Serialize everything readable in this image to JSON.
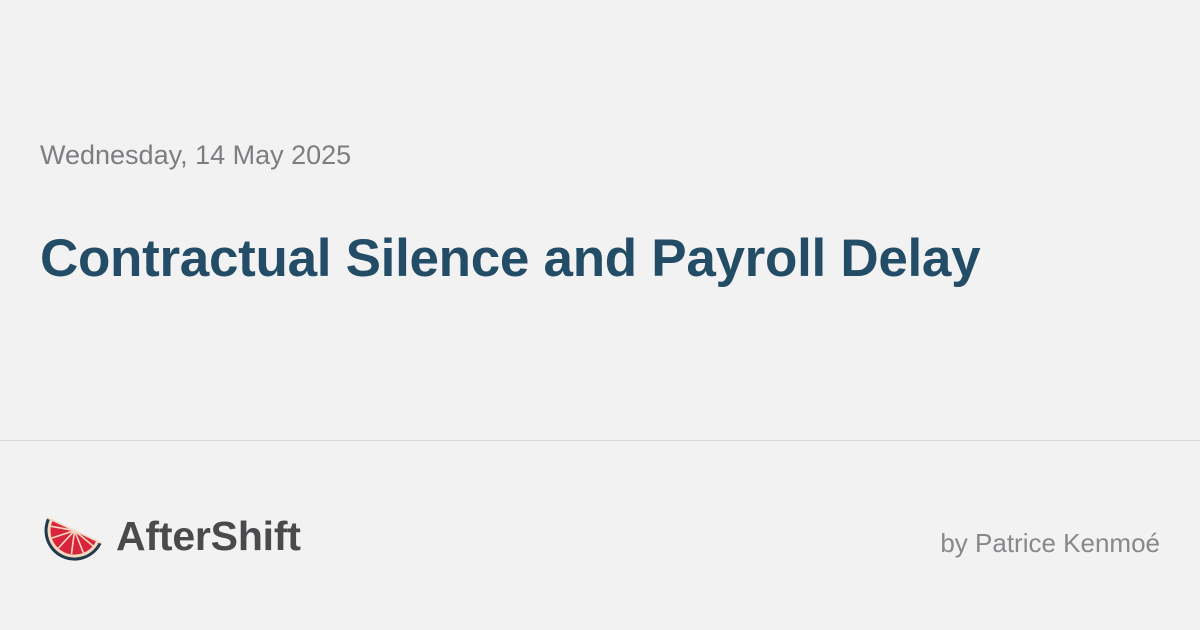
{
  "post": {
    "date": "Wednesday, 14 May 2025",
    "title": "Contractual Silence and Payroll Delay"
  },
  "brand": {
    "name": "AfterShift",
    "logo_icon": "grapefruit-slice-icon"
  },
  "author": {
    "byline": "by Patrice Kenmoé"
  },
  "colors": {
    "background": "#f2f2f3",
    "title": "#234c66",
    "date": "#7d7d82",
    "brand_text": "#4a4a4c",
    "byline": "#88888c",
    "logo_rind": "#1f3b4d",
    "logo_flesh": "#d9243d",
    "logo_pith": "#f4d8bf"
  }
}
